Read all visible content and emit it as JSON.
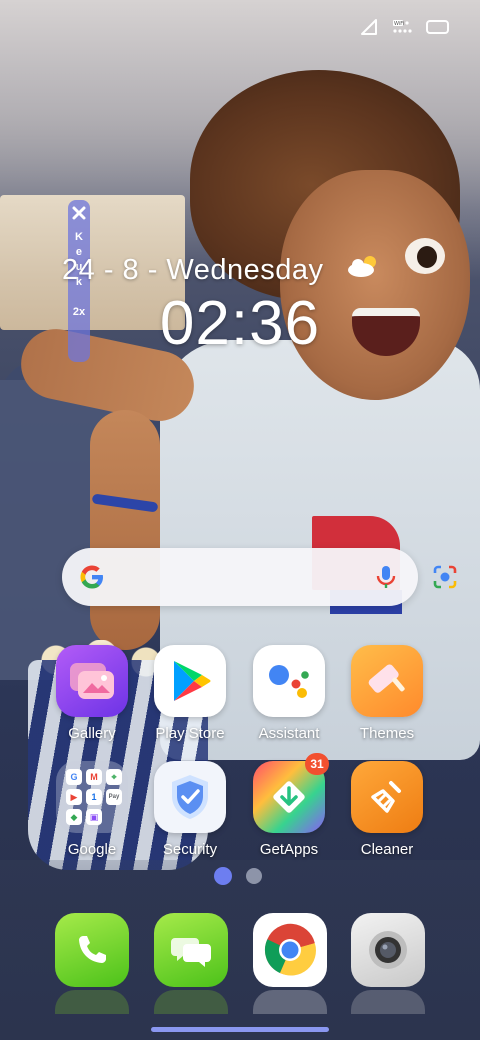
{
  "status_bar": {
    "icons": [
      "signal-icon",
      "wifi-icon",
      "battery-icon"
    ],
    "wifi_label": "WiFi"
  },
  "overlay": {
    "close_label": "✕",
    "letters": [
      "K",
      "e",
      "u",
      "k"
    ],
    "speed": "2x"
  },
  "clock": {
    "date": "24 - 8 - Wednesday",
    "time": "02:36",
    "weather_icon": "partly-cloudy-icon"
  },
  "search": {
    "logo": "G",
    "mic_icon": "mic-icon",
    "lens_icon": "lens-icon"
  },
  "apps": [
    {
      "label": "Gallery",
      "icon": "gallery-icon",
      "color": "#8a4df5"
    },
    {
      "label": "Play Store",
      "icon": "play-store-icon",
      "color": "#ffffff"
    },
    {
      "label": "Assistant",
      "icon": "assistant-icon",
      "color": "#ffffff"
    },
    {
      "label": "Themes",
      "icon": "themes-icon",
      "color": "#ff9e3d"
    },
    {
      "label": "Google",
      "icon": "folder-icon",
      "color": "#c8cddc"
    },
    {
      "label": "Security",
      "icon": "shield-icon",
      "color": "#ffffff"
    },
    {
      "label": "GetApps",
      "icon": "getapps-icon",
      "color": "#ff4d6a",
      "badge": "31"
    },
    {
      "label": "Cleaner",
      "icon": "broom-icon",
      "color": "#f08c1e"
    }
  ],
  "google_folder": {
    "mini_apps": [
      "G",
      "M",
      "⌖",
      "▶",
      "1",
      "Pay",
      "◆",
      "▣"
    ]
  },
  "page_indicator": {
    "pages": 2,
    "active": 0
  },
  "dock": [
    {
      "name": "phone",
      "icon": "phone-icon",
      "color": "#7ed321"
    },
    {
      "name": "messages",
      "icon": "messages-icon",
      "color": "#7ed321"
    },
    {
      "name": "chrome",
      "icon": "chrome-icon",
      "color": "#ffffff"
    },
    {
      "name": "camera",
      "icon": "camera-icon",
      "color": "#d6d6d6"
    }
  ]
}
